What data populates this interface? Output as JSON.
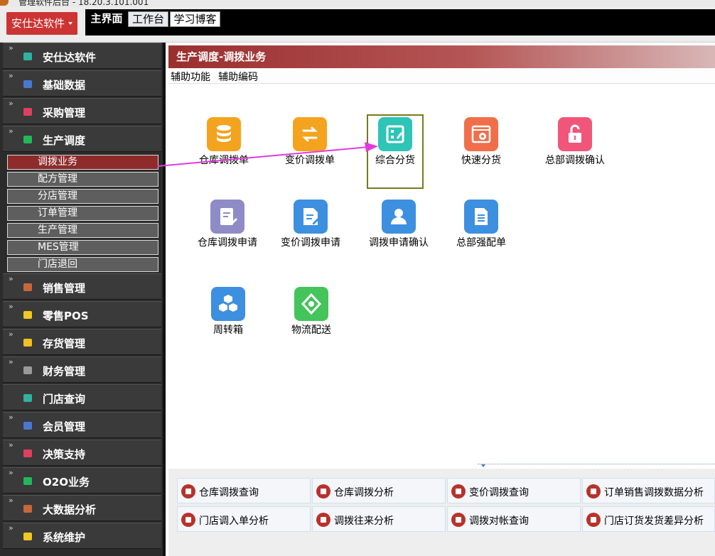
{
  "window": {
    "title": "管理软件后台 - 18.20.3.101.001"
  },
  "brand": {
    "label": "安仕达软件"
  },
  "top_tabs": [
    {
      "label": "主界面"
    },
    {
      "label": "工作台"
    },
    {
      "label": "学习博客"
    }
  ],
  "sidebar": {
    "items": [
      {
        "label": "安仕达软件",
        "color": "#2fb3a0"
      },
      {
        "label": "基础数据",
        "color": "#4a78d0"
      },
      {
        "label": "采购管理",
        "color": "#e04060"
      },
      {
        "label": "生产调度",
        "color": "#22b85a"
      },
      {
        "label": "销售管理",
        "color": "#c8673a"
      },
      {
        "label": "零售POS",
        "color": "#f0c820"
      },
      {
        "label": "存货管理",
        "color": "#f0c020"
      },
      {
        "label": "财务管理",
        "color": "#9a9a9a"
      },
      {
        "label": "门店查询",
        "color": "#2fb3a0"
      },
      {
        "label": "会员管理",
        "color": "#4a78d0"
      },
      {
        "label": "决策支持",
        "color": "#e04060"
      },
      {
        "label": "O2O业务",
        "color": "#22b85a"
      },
      {
        "label": "大数据分析",
        "color": "#c8673a"
      },
      {
        "label": "系统维护",
        "color": "#f0c820"
      }
    ],
    "subitems": [
      {
        "label": "调拨业务",
        "active": true
      },
      {
        "label": "配方管理"
      },
      {
        "label": "分店管理"
      },
      {
        "label": "订单管理"
      },
      {
        "label": "生产管理"
      },
      {
        "label": "MES管理"
      },
      {
        "label": "门店退回"
      }
    ]
  },
  "content": {
    "header": "生产调度-调拨业务",
    "helpbar": {
      "item1": "辅助功能",
      "item2": "辅助编码"
    }
  },
  "tiles": [
    {
      "label": "仓库调拨单",
      "icon": "coins-stack-icon",
      "color": "#f4a31e"
    },
    {
      "label": "变价调拨单",
      "icon": "exchange-arrows-icon",
      "color": "#f4a31e"
    },
    {
      "label": "综合分货",
      "icon": "grid-edit-icon",
      "color": "#2ec4b6"
    },
    {
      "label": "快速分货",
      "icon": "gear-window-icon",
      "color": "#f06f4a"
    },
    {
      "label": "总部调拨确认",
      "icon": "unlock-icon",
      "color": "#f0567a"
    },
    {
      "label": "仓库调拨申请",
      "icon": "note-pen-icon",
      "color": "#8e8bc6"
    },
    {
      "label": "变价调拨申请",
      "icon": "document-edit-icon",
      "color": "#3d8fe0"
    },
    {
      "label": "调拨申请确认",
      "icon": "user-icon",
      "color": "#3d8fe0"
    },
    {
      "label": "总部强配单",
      "icon": "checklist-icon",
      "color": "#3d8fe0"
    },
    {
      "label": "周转箱",
      "icon": "cubes-icon",
      "color": "#3d8fe0"
    },
    {
      "label": "物流配送",
      "icon": "recycle-icon",
      "color": "#44c45a"
    }
  ],
  "quick_links": [
    {
      "label": "仓库调拨查询",
      "icon": "report-icon"
    },
    {
      "label": "仓库调拨分析",
      "icon": "bar-chart-icon"
    },
    {
      "label": "变价调拨查询",
      "icon": "pie-chart-icon"
    },
    {
      "label": "订单销售调拨数据分析",
      "icon": "trend-chart-icon"
    },
    {
      "label": "门店调入单分析",
      "icon": "graduation-cap-icon"
    },
    {
      "label": "调拨往来分析",
      "icon": "globe-icon"
    },
    {
      "label": "调拨对帐查询",
      "icon": "report-icon"
    },
    {
      "label": "门店订货发货差异分析",
      "icon": "report-icon"
    }
  ]
}
